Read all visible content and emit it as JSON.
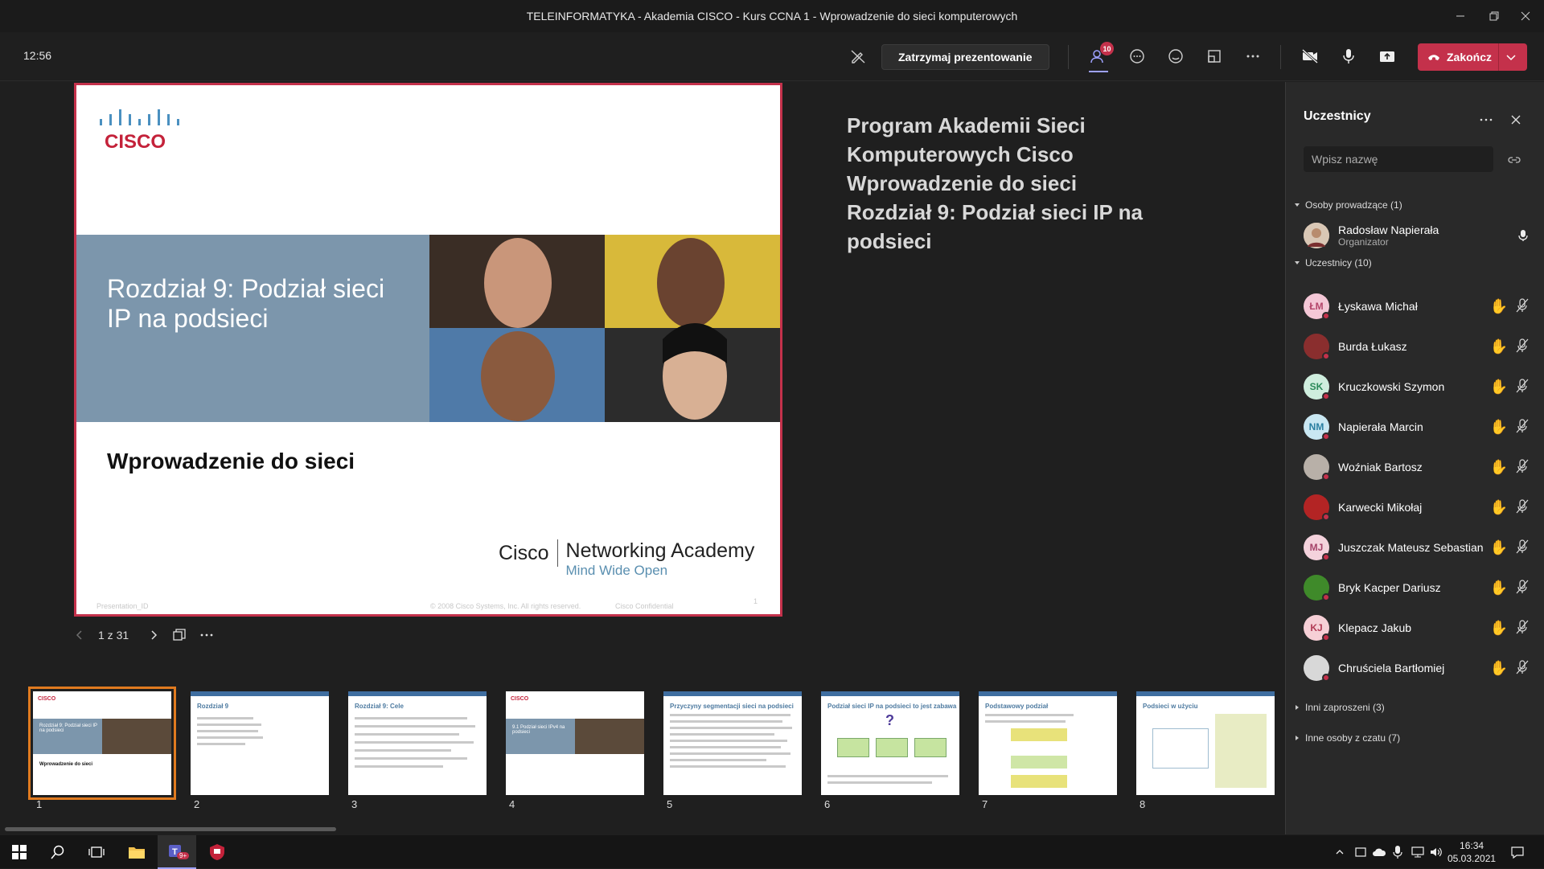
{
  "window": {
    "title": "TELEINFORMATYKA - Akademia CISCO - Kurs CCNA 1 - Wprowadzenie do sieci komputerowych"
  },
  "toolbar": {
    "timer": "12:56",
    "stop_presenting": "Zatrzymaj prezentowanie",
    "participants_badge": "10",
    "end_call": "Zakończ"
  },
  "slide": {
    "logo": "CISCO",
    "chapter": "Rozdział 9: Podział sieci IP na podsieci",
    "subtitle": "Wprowadzenie do sieci",
    "brand_cisco": "Cisco",
    "brand_academy": "Networking Academy",
    "brand_tagline": "Mind Wide Open",
    "footer_left": "Presentation_ID",
    "footer_mid": "© 2008 Cisco Systems, Inc. All rights reserved.",
    "footer_conf": "Cisco Confidential",
    "footer_page": "1"
  },
  "notes": {
    "lines": [
      "Program Akademii Sieci",
      "Komputerowych Cisco",
      "Wprowadzenie do sieci",
      "Rozdział 9: Podział sieci IP na",
      "podsieci"
    ]
  },
  "pager": {
    "label": "1 z 31"
  },
  "thumbnails": [
    {
      "num": "1",
      "title": "Rozdział 9: Podział sieci IP na podsieci"
    },
    {
      "num": "2",
      "title": "Rozdział 9"
    },
    {
      "num": "3",
      "title": "Rozdział 9: Cele"
    },
    {
      "num": "4",
      "title": "9.1 Podział sieci IPv4 na podsieci"
    },
    {
      "num": "5",
      "title": "Przyczyny segmentacji sieci na podsieci"
    },
    {
      "num": "6",
      "title": "Podział sieci IP na podsieci to jest zabawa"
    },
    {
      "num": "7",
      "title": "Podstawowy podział"
    },
    {
      "num": "8",
      "title": "Podsieci w użyciu"
    }
  ],
  "panel": {
    "title": "Uczestnicy",
    "search_placeholder": "Wpisz nazwę",
    "presenters_header": "Osoby prowadzące (1)",
    "presenter": {
      "name": "Radosław Napierała",
      "role": "Organizator"
    },
    "attendees_header": "Uczestnicy (10)",
    "attendees": [
      {
        "name": "Łyskawa Michał",
        "initials": "ŁM",
        "color": "#f4c7d6",
        "fg": "#b4456a"
      },
      {
        "name": "Burda Łukasz",
        "initials": "",
        "color": "#8a2e2e",
        "fg": "#fff"
      },
      {
        "name": "Kruczkowski Szymon",
        "initials": "SK",
        "color": "#cfeede",
        "fg": "#2c8a5a"
      },
      {
        "name": "Napierała Marcin",
        "initials": "NM",
        "color": "#c9e7f2",
        "fg": "#2a7fa1"
      },
      {
        "name": "Woźniak Bartosz",
        "initials": "",
        "color": "#b8b0a8",
        "fg": "#fff"
      },
      {
        "name": "Karwecki Mikołaj",
        "initials": "",
        "color": "#b32424",
        "fg": "#fff"
      },
      {
        "name": "Juszczak Mateusz Sebastian",
        "initials": "MJ",
        "color": "#f4d2dc",
        "fg": "#a6436a"
      },
      {
        "name": "Bryk Kacper Dariusz",
        "initials": "",
        "color": "#3f8a2a",
        "fg": "#fff"
      },
      {
        "name": "Klepacz Jakub",
        "initials": "KJ",
        "color": "#f6cfd6",
        "fg": "#b13b55"
      },
      {
        "name": "Chruściela Bartłomiej",
        "initials": "",
        "color": "#d8d8d8",
        "fg": "#333"
      }
    ],
    "invited": "Inni zaproszeni (3)",
    "chat_others": "Inne osoby z czatu (7)"
  },
  "taskbar": {
    "time": "16:34",
    "date": "05.03.2021",
    "teams_badge": "9+"
  },
  "colors": {
    "accent": "#c4314b",
    "thumb_active": "#e07a1f",
    "slide_band": "#7c96ac"
  }
}
